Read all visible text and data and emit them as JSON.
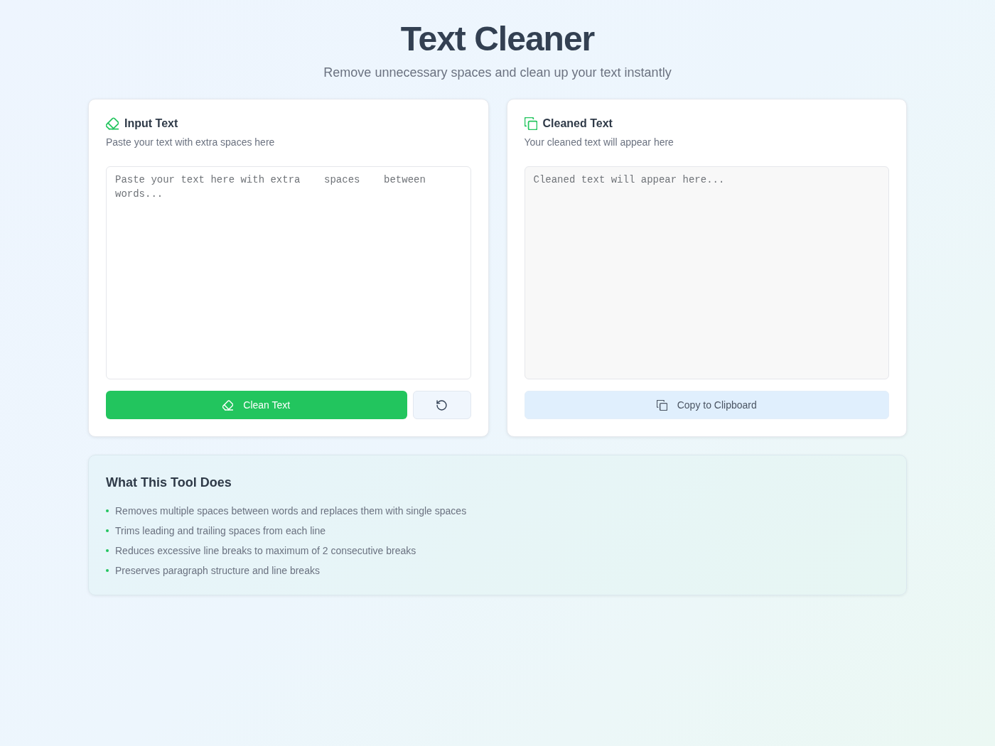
{
  "header": {
    "title": "Text Cleaner",
    "subtitle": "Remove unnecessary spaces and clean up your text instantly"
  },
  "panels": [
    {
      "kind": "input",
      "title": "Input Text",
      "description": "Paste your text with extra spaces here",
      "placeholder": "Paste your text here with extra    spaces    between words...",
      "actions": [
        {
          "kind": "primary",
          "label": "Clean Text"
        },
        {
          "kind": "reset"
        }
      ]
    },
    {
      "kind": "output",
      "title": "Cleaned Text",
      "description": "Your cleaned text will appear here",
      "placeholder": "Cleaned text will appear here...",
      "actions": [
        {
          "kind": "copy",
          "label": "Copy to Clipboard"
        }
      ]
    }
  ],
  "info": {
    "title": "What This Tool Does",
    "items": [
      "Removes multiple spaces between words and replaces them with single spaces",
      "Trims leading and trailing spaces from each line",
      "Reduces excessive line breaks to maximum of 2 consecutive breaks",
      "Preserves paragraph structure and line breaks"
    ]
  }
}
